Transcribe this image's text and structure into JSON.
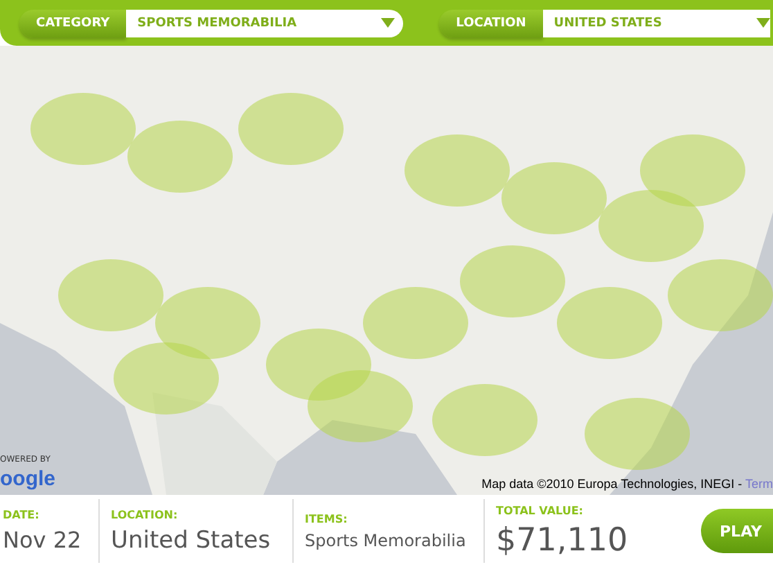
{
  "filters": [
    {
      "label": "CATEGORY",
      "value": "SPORTS MEMORABILIA"
    },
    {
      "label": "LOCATION",
      "value": "UNITED STATES"
    }
  ],
  "map": {
    "kind": "picture",
    "powered_by": "OWERED BY",
    "logo": "oogle",
    "attribution": "Map data ©2010 Europa Technologies, INEGI - ",
    "terms_link": "Term"
  },
  "stats": [
    {
      "label": "DATE:",
      "value": "Nov 22",
      "kind": "text"
    },
    {
      "label": "LOCATION:",
      "value": "United States",
      "kind": "text"
    },
    {
      "label": "ITEMS:",
      "value": "Sports Memorabilia",
      "kind": "small"
    },
    {
      "label": "TOTAL VALUE:",
      "value": "$71,110",
      "kind": "big"
    }
  ],
  "play_button": "PLAY"
}
